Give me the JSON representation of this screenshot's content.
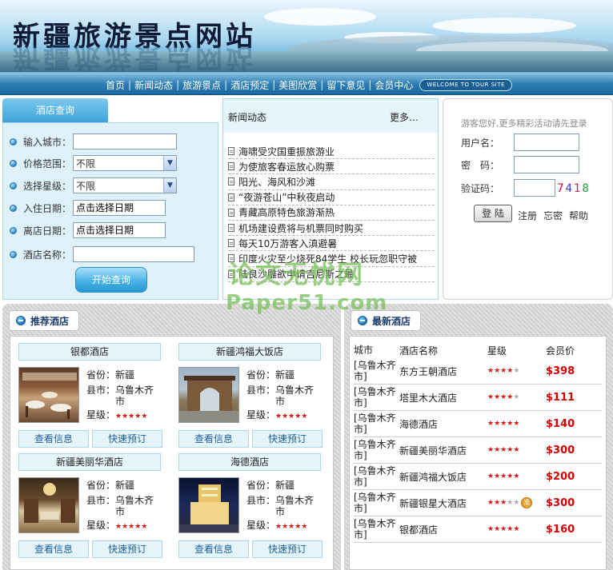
{
  "banner": {
    "title": "新疆旅游景点网站"
  },
  "nav": {
    "items": [
      "首页",
      "新闻动态",
      "旅游景点",
      "酒店预定",
      "美图欣赏",
      "留下意见",
      "会员中心"
    ],
    "badge": "WELCOME TO TOUR SITE"
  },
  "search": {
    "tab_title": "酒店查询",
    "fields": [
      {
        "label": "输入城市：",
        "value": ""
      },
      {
        "label": "价格范围：",
        "value": "不限"
      },
      {
        "label": "选择星级：",
        "value": "不限"
      },
      {
        "label": "入住日期：",
        "value": "点击选择日期"
      },
      {
        "label": "离店日期：",
        "value": "点击选择日期"
      },
      {
        "label": "酒店名称：",
        "value": ""
      }
    ],
    "button": "开始查询"
  },
  "news": {
    "title": "新闻动态",
    "more": "更多…",
    "items": [
      "海啸受灾国重振旅游业",
      "为使旅客春运放心购票",
      "阳光、海风和沙滩",
      "“夜游苍山”中秋夜启动",
      "青藏高原特色旅游渐热",
      "机场建设费将与机票同时购买",
      "每天10万游客入滇避暑",
      "印度火灾至少烧死84学生 校长玩忽职守被",
      "陆良沙雕欲申请吉尼斯之最"
    ]
  },
  "login": {
    "notice": "游客您好,更多精彩活动请先登录",
    "username_label": "用户名：",
    "password_label": "密　码：",
    "captcha_label": "验证码：",
    "captcha_chars": [
      "7",
      "4",
      "1",
      "8"
    ],
    "captcha_colors": [
      "#d0021b",
      "#3a3ad6",
      "#cc2255",
      "#2a9a3a"
    ],
    "login_button": "登 陆",
    "register": "注册",
    "forgot": "忘密",
    "help": "帮助"
  },
  "watermark": {
    "line1": "论文无忧网",
    "line2": "Paper51.com"
  },
  "recommended": {
    "title": "推荐酒店",
    "hotels": [
      {
        "name": "银都酒店",
        "province_label": "省份：",
        "province": "新疆",
        "city_label": "县市：",
        "city": "乌鲁木齐市",
        "star_label": "星级：",
        "stars": 5,
        "view": "查看信息",
        "book": "快速预订"
      },
      {
        "name": "新疆鸿福大饭店",
        "province_label": "省份：",
        "province": "新疆",
        "city_label": "县市：",
        "city": "乌鲁木齐市",
        "star_label": "星级：",
        "stars": 5,
        "view": "查看信息",
        "book": "快速预订"
      },
      {
        "name": "新疆美丽华酒店",
        "province_label": "省份：",
        "province": "新疆",
        "city_label": "县市：",
        "city": "乌鲁木齐市",
        "star_label": "星级：",
        "stars": 5,
        "view": "查看信息",
        "book": "快速预订"
      },
      {
        "name": "海德酒店",
        "province_label": "省份：",
        "province": "新疆",
        "city_label": "县市：",
        "city": "乌鲁木齐市",
        "star_label": "星级：",
        "stars": 5,
        "view": "查看信息",
        "book": "快速预订"
      }
    ]
  },
  "latest": {
    "title": "最新酒店",
    "headers": [
      "城市",
      "酒店名称",
      "星级",
      "会员价"
    ],
    "rows": [
      {
        "city": "[乌鲁木齐市]",
        "name": "东方王朝酒店",
        "stars": 4,
        "price": "$398"
      },
      {
        "city": "[乌鲁木齐市]",
        "name": "塔里木大酒店",
        "stars": 4,
        "price": "$111"
      },
      {
        "city": "[乌鲁木齐市]",
        "name": "海德酒店",
        "stars": 5,
        "price": "$140"
      },
      {
        "city": "[乌鲁木齐市]",
        "name": "新疆美丽华酒店",
        "stars": 5,
        "price": "$300"
      },
      {
        "city": "[乌鲁木齐市]",
        "name": "新疆鸿福大饭店",
        "stars": 5,
        "price": "$200"
      },
      {
        "city": "[乌鲁木齐市]",
        "name": "新疆银星大酒店",
        "stars": 3,
        "price": "$300",
        "badge": "准"
      },
      {
        "city": "[乌鲁木齐市]",
        "name": "银都酒店",
        "stars": 5,
        "price": "$160"
      }
    ]
  }
}
